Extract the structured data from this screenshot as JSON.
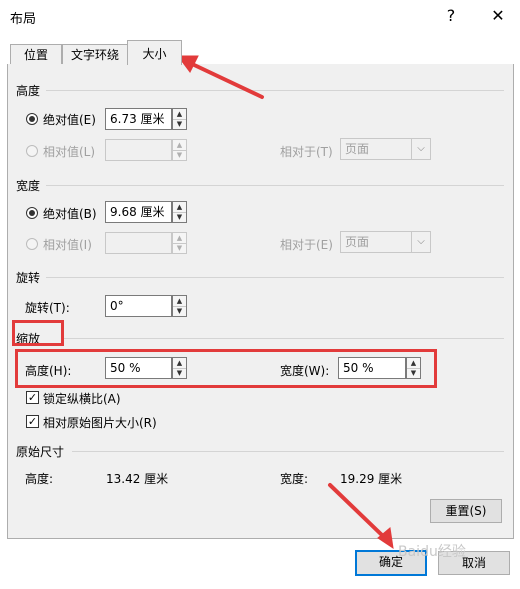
{
  "window": {
    "title": "布局",
    "help": "?",
    "close": "✕"
  },
  "tabs": [
    "位置",
    "文字环绕",
    "大小"
  ],
  "height": {
    "header": "高度",
    "absolute_label": "绝对值(E)",
    "absolute_value": "6.73 厘米",
    "relative_label": "相对值(L)",
    "relative_to_label": "相对于(T)",
    "relative_to_value": "页面"
  },
  "width": {
    "header": "宽度",
    "absolute_label": "绝对值(B)",
    "absolute_value": "9.68 厘米",
    "relative_label": "相对值(I)",
    "relative_to_label": "相对于(E)",
    "relative_to_value": "页面"
  },
  "rotation": {
    "header": "旋转",
    "label": "旋转(T):",
    "value": "0°"
  },
  "scale": {
    "header": "缩放",
    "height_label": "高度(H):",
    "height_value": "50 %",
    "width_label": "宽度(W):",
    "width_value": "50 %",
    "lock_ratio_label": "锁定纵横比(A)",
    "lock_ratio_checked": true,
    "relative_original_label": "相对原始图片大小(R)",
    "relative_original_checked": true
  },
  "original": {
    "header": "原始尺寸",
    "height_label": "高度:",
    "height_value": "13.42 厘米",
    "width_label": "宽度:",
    "width_value": "19.29 厘米"
  },
  "buttons": {
    "reset": "重置(S)",
    "ok": "确定",
    "cancel": "取消"
  },
  "icons": {
    "spin_up": "▲",
    "spin_down": "▼",
    "dropdown": "⌵",
    "check": "✓"
  },
  "watermark": "Baidu经验",
  "colors": {
    "highlight": "#e23b3b",
    "default_button_border": "#0078d7"
  }
}
